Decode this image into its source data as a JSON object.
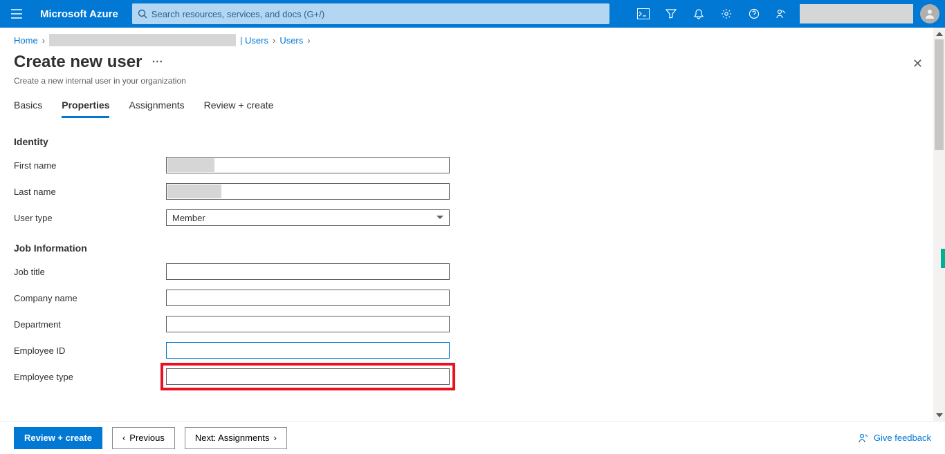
{
  "topbar": {
    "brand": "Microsoft Azure",
    "search_placeholder": "Search resources, services, and docs (G+/)"
  },
  "breadcrumb": {
    "home": "Home",
    "users_seg": "| Users",
    "users": "Users"
  },
  "header": {
    "title": "Create new user",
    "subtitle": "Create a new internal user in your organization"
  },
  "tabs": {
    "basics": "Basics",
    "properties": "Properties",
    "assignments": "Assignments",
    "review": "Review + create"
  },
  "sections": {
    "identity": "Identity",
    "job": "Job Information"
  },
  "labels": {
    "first_name": "First name",
    "last_name": "Last name",
    "user_type": "User type",
    "job_title": "Job title",
    "company_name": "Company name",
    "department": "Department",
    "employee_id": "Employee ID",
    "employee_type": "Employee type"
  },
  "values": {
    "user_type_selected": "Member"
  },
  "footer": {
    "review": "Review + create",
    "previous": "Previous",
    "next": "Next: Assignments",
    "feedback": "Give feedback"
  }
}
